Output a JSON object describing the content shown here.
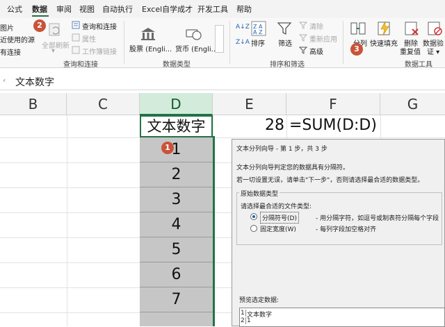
{
  "menubar": {
    "tabs": [
      "公式",
      "数据",
      "审阅",
      "视图",
      "自动执行",
      "Excel自学成才",
      "开发工具",
      "帮助"
    ],
    "active_tab": "数据"
  },
  "ribbon": {
    "get_data": {
      "item1": "图片",
      "item2": "近使用的源",
      "item3": "有连接",
      "refresh_all": "全部刷新",
      "queries_connections": "查询和连接",
      "properties": "属性",
      "workbook_links": "工作簿链接",
      "group_label": "查询和连接"
    },
    "data_types": {
      "stocks": "股票 (Engli...",
      "currencies": "货币 (Engli...",
      "group_label": "数据类型"
    },
    "sort_filter": {
      "sort": "排序",
      "filter": "筛选",
      "clear": "清除",
      "reapply": "重新应用",
      "advanced": "高级",
      "group_label": "排序和筛选"
    },
    "data_tools": {
      "text_to_columns": "分列",
      "flash_fill": "快速填充",
      "remove_duplicates_1": "删除",
      "remove_duplicates_2": "重复值",
      "data_validation_1": "数据验",
      "data_validation_2": "证 ▾",
      "group_label": "数据工具"
    },
    "badges": [
      "2",
      "3"
    ]
  },
  "formula_bar": {
    "content": "文本数字"
  },
  "columns": [
    "B",
    "C",
    "D",
    "E",
    "F",
    "G"
  ],
  "sheet": {
    "d_header": "文本数字",
    "d_values": [
      "1",
      "2",
      "3",
      "4",
      "5",
      "6",
      "7"
    ],
    "e_value": "28",
    "f_formula": "=SUM(D:D)",
    "badge1": "1"
  },
  "dialog": {
    "title": "文本分列向导 - 第 1 步，共 3 步",
    "line1": "文本分列向导判定您的数据具有分隔符。",
    "line2": "若一切设置无误，请单击\"下一步\"，否则请选择最合适的数据类型。",
    "section": "原始数据类型",
    "choose": "请选择最合适的文件类型:",
    "option1_label": "分隔符号(D)",
    "option1_desc": "- 用分隔字符，如逗号或制表符分隔每个字段",
    "option2_label": "固定宽度(W)",
    "option2_desc": "- 每列字段加空格对齐",
    "preview_label": "预览选定数据:",
    "preview_row1_num": "1",
    "preview_row1_text": "文本数字",
    "preview_row2_num": "2",
    "preview_row2_text": "1"
  },
  "colors": {
    "excel_green": "#217346",
    "badge": "#c9533a",
    "selected_column": "#c6c6c6"
  }
}
